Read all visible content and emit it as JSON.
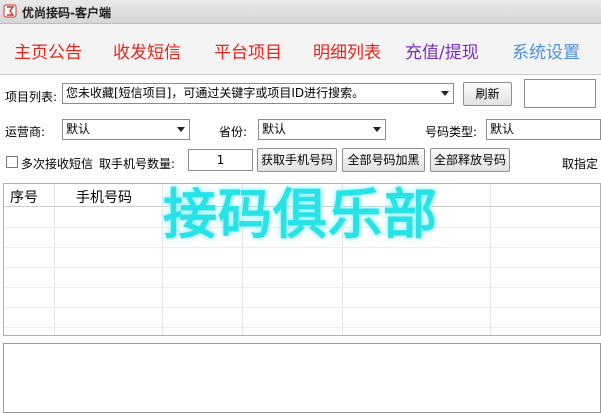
{
  "window": {
    "title": "优尚接码-客户端"
  },
  "menu": {
    "items": [
      {
        "label": "主页公告",
        "color": "#e8251c"
      },
      {
        "label": "收发短信",
        "color": "#e8251c"
      },
      {
        "label": "平台项目",
        "color": "#e8251c"
      },
      {
        "label": "明细列表",
        "color": "#e8251c"
      },
      {
        "label": "充值/提现",
        "color": "#7b2fbe"
      },
      {
        "label": "系统设置",
        "color": "#4d8fe0"
      }
    ]
  },
  "form": {
    "project_label": "项目列表:",
    "project_value": "您未收藏[短信项目]，可通过关键字或项目ID进行搜索。",
    "refresh_label": "刷新",
    "search_value": "",
    "carrier_label": "运营商:",
    "carrier_value": "默认",
    "province_label": "省份:",
    "province_value": "默认",
    "number_type_label": "号码类型:",
    "number_type_value": "默认",
    "multi_receive_label": "多次接收短信",
    "quantity_label": "取手机号数量:",
    "quantity_value": "1",
    "get_number_label": "获取手机号码",
    "blacklist_all_label": "全部号码加黑",
    "release_all_label": "全部释放号码",
    "specify_label": "取指定"
  },
  "grid": {
    "columns": [
      "序号",
      "手机号码"
    ]
  },
  "watermark": {
    "text": "接码俱乐部",
    "color": "#27e3e8"
  }
}
